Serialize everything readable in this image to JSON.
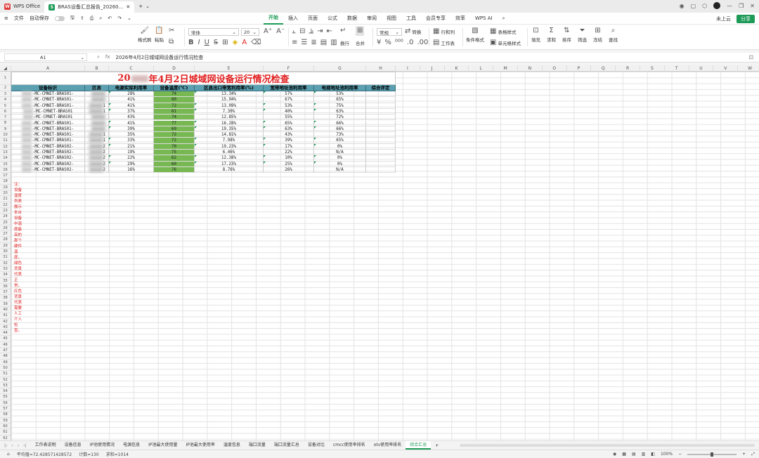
{
  "titlebar": {
    "app_tab": "WPS Office",
    "file_tab": "BRAS设备汇总报告_20260...",
    "new_tab_symbol": "+"
  },
  "menubar": {
    "file": "文件",
    "autosave": "自动保存",
    "tabs": [
      "开始",
      "插入",
      "页面",
      "公式",
      "数据",
      "审阅",
      "视图",
      "工具",
      "会员专享",
      "效率",
      "WPS AI"
    ],
    "cloud": "未上云",
    "share": "分享"
  },
  "ribbon": {
    "format_painter": "格式刷",
    "paste": "粘贴",
    "font_name": "宋体",
    "font_size": "20",
    "wrap": "换行",
    "merge": "合并",
    "number_format": "常规",
    "convert": "转换",
    "row_col": "行和列",
    "worksheet": "工作表",
    "cond_format": "条件格式",
    "table_style": "表格样式",
    "cell_style": "单元格样式",
    "fill": "填充",
    "sum": "求和",
    "sort": "排序",
    "filter": "筛选",
    "freeze": "冻结",
    "find": "查找"
  },
  "formula_bar": {
    "cell_ref": "A1",
    "content": "2026年4月2日城域网设备运行情况检查"
  },
  "sheet": {
    "columns": [
      "A",
      "B",
      "C",
      "D",
      "E",
      "F",
      "G",
      "H",
      "I",
      "J",
      "K",
      "L",
      "M",
      "N",
      "O",
      "P",
      "Q",
      "R",
      "S",
      "T",
      "U",
      "V",
      "W"
    ],
    "title_prefix": "20",
    "title_suffix": "年4月2日城域网设备运行情况检查",
    "headers": [
      "设备标识",
      "区县",
      "电源实际利用率",
      "设备温度(℃)",
      "区县出口带宽利用率(%)",
      "宽带地址池利用率",
      "电视地址池利用率",
      "综合评定"
    ],
    "rows": [
      {
        "device": "-MC-CMNET-BRAS01-",
        "region": "",
        "power": "28%",
        "temp": "74",
        "bw": "13.34%",
        "bbpool": "57%",
        "tvpool": "53%"
      },
      {
        "device": "-MC-CMNET-BRAS01-",
        "region": "",
        "power": "41%",
        "temp": "80",
        "bw": "15.94%",
        "bbpool": "67%",
        "tvpool": "65%"
      },
      {
        "device": "-MC-CMNET-BRAS01-",
        "region": "1",
        "power": "41%",
        "temp": "72",
        "bw": "13.09%",
        "bbpool": "53%",
        "tvpool": "75%"
      },
      {
        "device": "-MC-CMNET-BRAS01",
        "region": "1",
        "power": "37%",
        "temp": "81",
        "bw": "7.30%",
        "bbpool": "40%",
        "tvpool": "63%"
      },
      {
        "device": "-MC-CMNET-BRAS01",
        "region": "",
        "power": "43%",
        "temp": "74",
        "bw": "12.85%",
        "bbpool": "55%",
        "tvpool": "72%"
      },
      {
        "device": "-MC-CMNET-BRAS01-",
        "region": "",
        "power": "41%",
        "temp": "77",
        "bw": "16.28%",
        "bbpool": "65%",
        "tvpool": "66%"
      },
      {
        "device": "-MC-CMNET-BRAS01-",
        "region": "",
        "power": "39%",
        "temp": "69",
        "bw": "19.35%",
        "bbpool": "63%",
        "tvpool": "66%"
      },
      {
        "device": "-MC-CMNET-BRAS01-",
        "region": "1",
        "power": "35%",
        "temp": "72",
        "bw": "14.81%",
        "bbpool": "43%",
        "tvpool": "73%"
      },
      {
        "device": "-MC-CMNET-BRAS01-",
        "region": "1",
        "power": "33%",
        "temp": "72",
        "bw": "7.98%",
        "bbpool": "39%",
        "tvpool": "65%"
      },
      {
        "device": "-MC-CMNET-BRAS02-",
        "region": "2",
        "power": "21%",
        "temp": "70",
        "bw": "19.23%",
        "bbpool": "17%",
        "tvpool": "0%"
      },
      {
        "device": "-MC-CMNET-BRAS02-",
        "region": "2",
        "power": "19%",
        "temp": "75",
        "bw": "6.46%",
        "bbpool": "22%",
        "tvpool": "N/A"
      },
      {
        "device": "-MC-CMNET-BRAS02-",
        "region": "2",
        "power": "22%",
        "temp": "62",
        "bw": "12.38%",
        "bbpool": "10%",
        "tvpool": "0%"
      },
      {
        "device": "-MC-CMNET-BRAS02-",
        "region": "2",
        "power": "29%",
        "temp": "60",
        "bw": "17.23%",
        "bbpool": "25%",
        "tvpool": "0%"
      },
      {
        "device": "-MC-CMNET-BRAS02-",
        "region": "2",
        "power": "16%",
        "temp": "76",
        "bw": "8.76%",
        "bbpool": "26%",
        "tvpool": "N/A"
      }
    ],
    "note": "注：设备温度列表展示本台设备中温度最高的那个硬件温度，绿色背景代表正常，红色背景代表需要人工介入检查。",
    "temp_bg_color": "#77b852",
    "header_bg_color": "#5aa0b0",
    "title_color": "#e02020"
  },
  "sheet_tabs": [
    "工作表说明",
    "设备信息",
    "IP池使用情况",
    "电源信息",
    "IP池最大使用量",
    "IP池最大使用率",
    "温度信息",
    "端口流量",
    "端口流量汇总",
    "设备对比",
    "cmcc使用率排名",
    "otv使用率排名",
    "综合汇总"
  ],
  "active_sheet_tab": "综合汇总",
  "status": {
    "average": "平均值=72.428571428572",
    "count": "计数=130",
    "sum": "求和=1014",
    "zoom": "100%"
  }
}
